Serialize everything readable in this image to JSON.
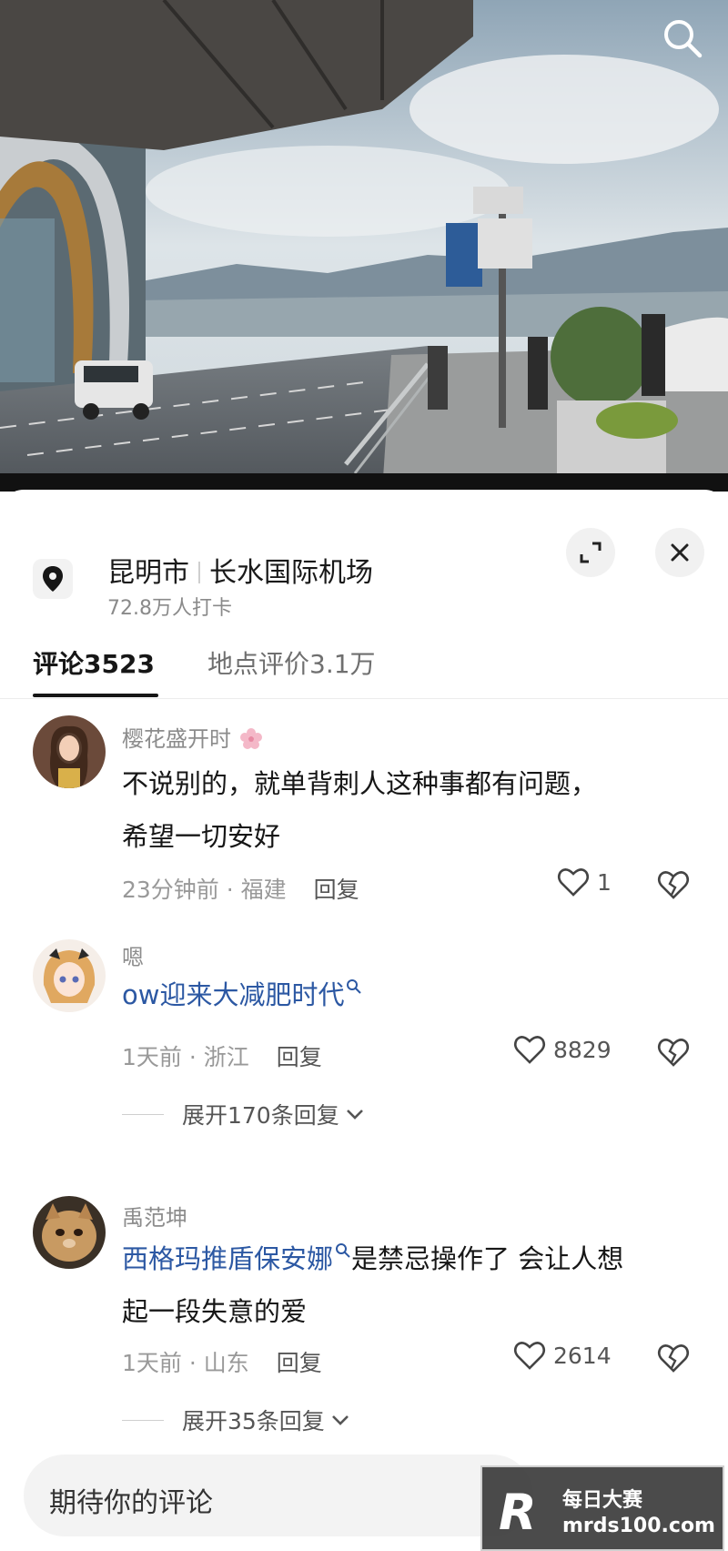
{
  "location": {
    "city": "昆明市",
    "place": "长水国际机场",
    "checkins": "72.8万人打卡"
  },
  "tabs": [
    {
      "label": "评论3523"
    },
    {
      "label": "地点评价3.1万"
    }
  ],
  "comments": [
    {
      "user": "樱花盛开时",
      "text_lines": [
        "不说别的，就单背刺人这种事都有问题，",
        "希望一切安好"
      ],
      "time_loc": "23分钟前 · 福建",
      "reply": "回复",
      "likes": "1"
    },
    {
      "user": "嗯",
      "keyword": "ow迎来大减肥时代",
      "time_loc": "1天前 · 浙江",
      "reply": "回复",
      "likes": "8829",
      "expand": "展开170条回复"
    },
    {
      "user": "禹范坤",
      "keyword": "西格玛推盾保安娜",
      "text_after": "是禁忌操作了 会让人想",
      "text_line2": "起一段失意的爱",
      "time_loc": "1天前 · 山东",
      "reply": "回复",
      "likes": "2614",
      "expand": "展开35条回复"
    }
  ],
  "input": {
    "placeholder": "期待你的评论"
  },
  "watermark": {
    "cn": "每日大赛",
    "url": "mrds100.com",
    "logo": "R"
  },
  "colors": {
    "keyword": "#2c58a3",
    "sky": "#c9d6e0"
  },
  "icons": [
    "search-icon",
    "location-pin-icon",
    "expand-icon",
    "close-icon",
    "heart-icon",
    "broken-heart-icon",
    "chevron-down-icon",
    "search-small-icon",
    "sakura-icon"
  ]
}
